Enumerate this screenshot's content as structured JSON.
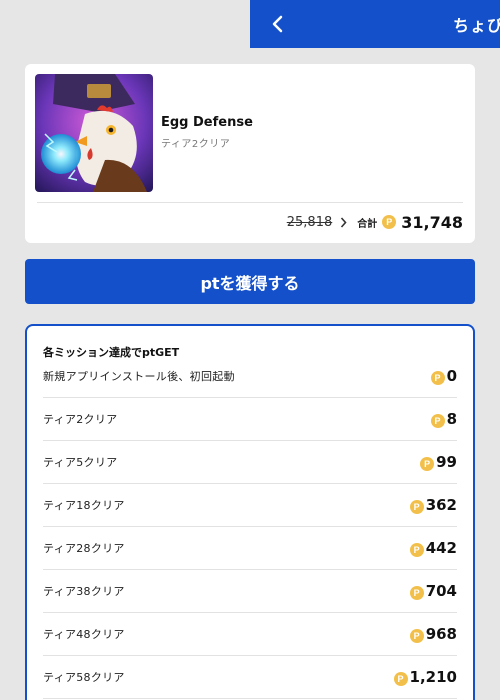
{
  "header": {
    "title": "ちょび"
  },
  "app": {
    "name": "Egg Defense",
    "subtitle": "ティア2クリア",
    "old_price": "25,818",
    "total_label": "合計",
    "total_price": "31,748"
  },
  "cta": {
    "label": "ptを獲得する"
  },
  "missions": {
    "heading": "各ミッション達成でptGET",
    "items": [
      {
        "label": "新規アプリインストール後、初回起動",
        "points": "0"
      },
      {
        "label": "ティア2クリア",
        "points": "8"
      },
      {
        "label": "ティア5クリア",
        "points": "99"
      },
      {
        "label": "ティア18クリア",
        "points": "362"
      },
      {
        "label": "ティア28クリア",
        "points": "442"
      },
      {
        "label": "ティア38クリア",
        "points": "704"
      },
      {
        "label": "ティア48クリア",
        "points": "968"
      },
      {
        "label": "ティア58クリア",
        "points": "1,210"
      }
    ]
  },
  "coin_symbol": "P",
  "icons": {
    "back": "chevron-left-icon",
    "arrow": "chevron-right-icon",
    "coin": "point-coin-icon",
    "app": "app-icon-rooster-wizard"
  },
  "colors": {
    "primary": "#1450c9",
    "coin": "#f2c04a",
    "background": "#e6e6e6"
  }
}
